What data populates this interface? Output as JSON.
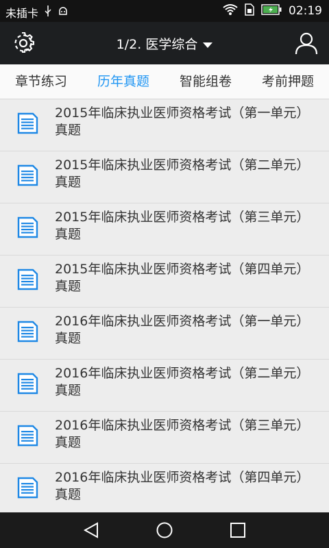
{
  "status_bar": {
    "carrier": "未插卡",
    "time": "02:19",
    "icons": [
      "usb-icon",
      "android-debug-icon",
      "wifi-icon",
      "sim-icon",
      "battery-charging-icon"
    ]
  },
  "app_bar": {
    "title": "1/2. 医学综合",
    "left_icon": "gear-icon",
    "right_icon": "user-icon"
  },
  "tabs": [
    {
      "label": "章节练习",
      "active": false
    },
    {
      "label": "历年真题",
      "active": true
    },
    {
      "label": "智能组卷",
      "active": false
    },
    {
      "label": "考前押题",
      "active": false
    }
  ],
  "list": {
    "items": [
      {
        "title": "2015年临床执业医师资格考试（第一单元）真题"
      },
      {
        "title": "2015年临床执业医师资格考试（第二单元）真题"
      },
      {
        "title": "2015年临床执业医师资格考试（第三单元）真题"
      },
      {
        "title": "2015年临床执业医师资格考试（第四单元）真题"
      },
      {
        "title": "2016年临床执业医师资格考试（第一单元）真题"
      },
      {
        "title": "2016年临床执业医师资格考试（第二单元）真题"
      },
      {
        "title": "2016年临床执业医师资格考试（第三单元）真题"
      },
      {
        "title": "2016年临床执业医师资格考试（第四单元）真题"
      }
    ]
  },
  "colors": {
    "accent": "#2196f3",
    "app_bar": "#1d1f21",
    "status_bar": "#131313",
    "list_bg": "#ededed"
  }
}
